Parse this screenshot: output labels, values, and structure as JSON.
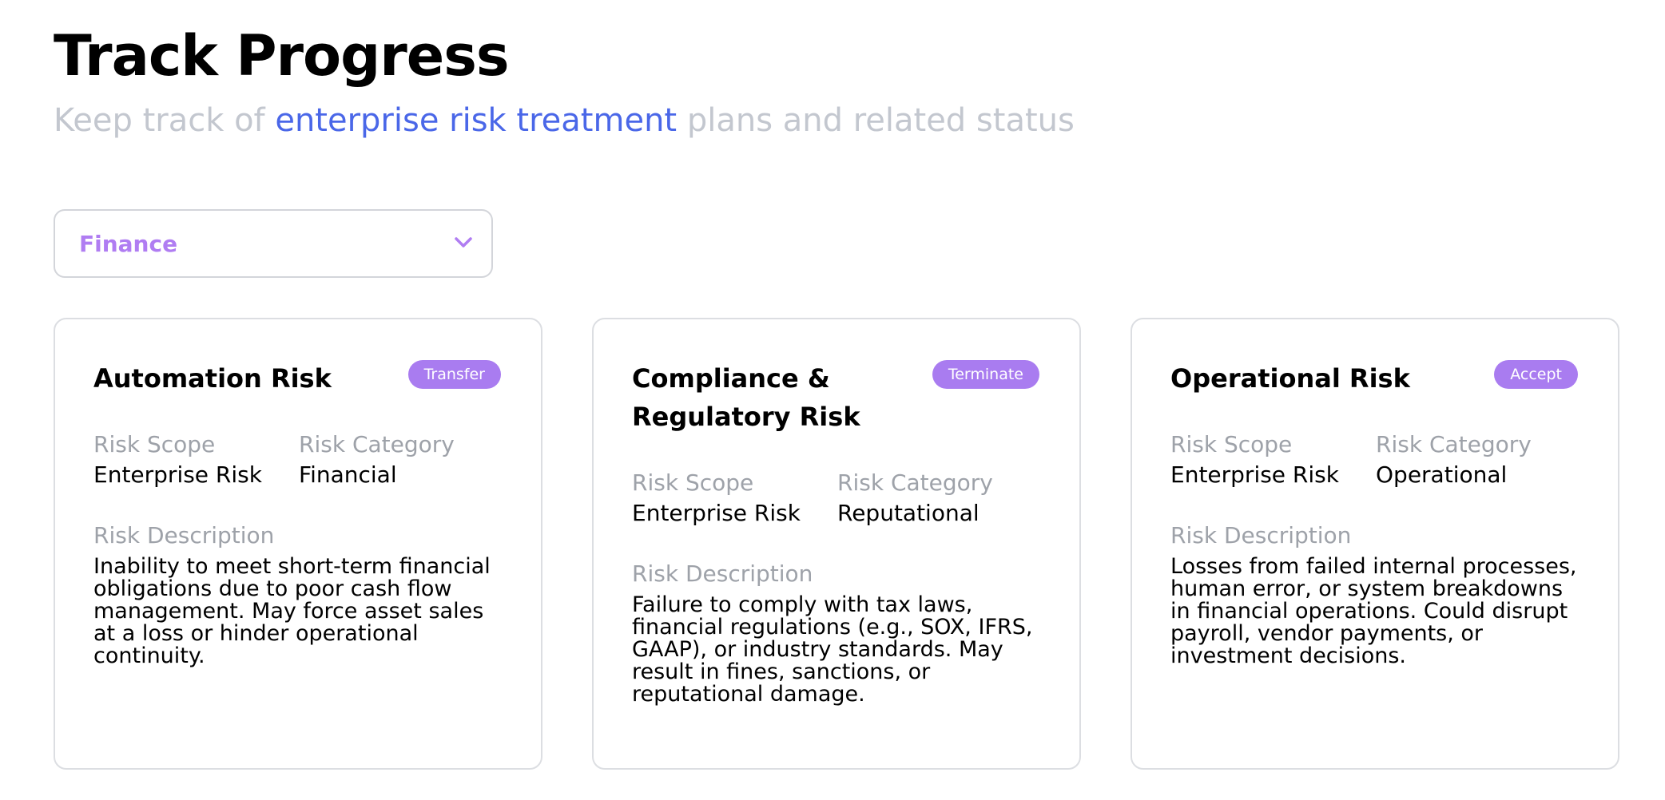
{
  "header": {
    "title": "Track Progress",
    "subtitle_pre": "Keep track of ",
    "subtitle_highlight": "enterprise risk treatment",
    "subtitle_post": " plans and related status"
  },
  "filter": {
    "selected": "Finance",
    "icon": "chevron-down-icon"
  },
  "labels": {
    "scope": "Risk Scope",
    "category": "Risk Category",
    "description": "Risk Description"
  },
  "cards": [
    {
      "title": "Automation Risk",
      "badge": "Transfer",
      "scope": "Enterprise Risk",
      "category": "Financial",
      "description": "Inability to meet short-term financial obligations due to poor cash flow management. May force asset sales at a loss or hinder operational continuity."
    },
    {
      "title": "Compliance & Regulatory Risk",
      "badge": "Terminate",
      "scope": "Enterprise Risk",
      "category": "Reputational",
      "description": "Failure to comply with tax laws, financial regulations (e.g., SOX, IFRS, GAAP), or industry standards. May result in fines, sanctions, or reputational damage."
    },
    {
      "title": "Operational Risk",
      "badge": "Accept",
      "scope": "Enterprise Risk",
      "category": "Operational",
      "description": "Losses from failed internal processes, human error, or system breakdowns in financial operations. Could disrupt payroll, vendor payments, or investment decisions."
    }
  ],
  "colors": {
    "accent_blue": "#4a67e8",
    "badge_purple": "#a97cf0",
    "filter_text": "#b07df2",
    "muted_text": "#c3c7cf",
    "label_text": "#9ea2a9"
  }
}
